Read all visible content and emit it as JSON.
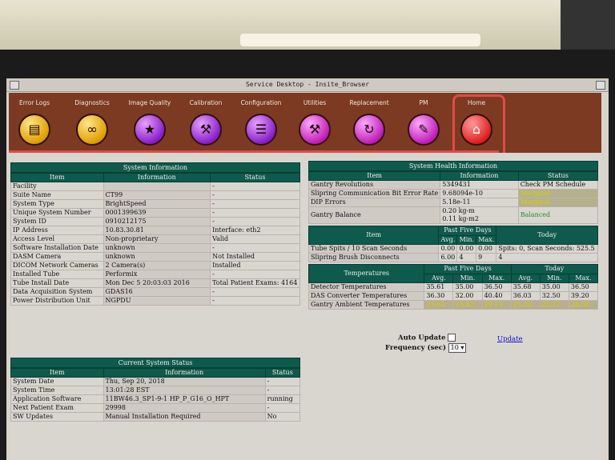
{
  "window": {
    "title": "Service Desktop - Insite_Browser"
  },
  "nav": {
    "items": [
      {
        "label": "Error Logs",
        "icon": "error-log-icon"
      },
      {
        "label": "Diagnostics",
        "icon": "stethoscope-icon"
      },
      {
        "label": "Image Quality",
        "icon": "monitor-star-icon"
      },
      {
        "label": "Calibration",
        "icon": "wrench-icon"
      },
      {
        "label": "Configuration",
        "icon": "checklist-icon"
      },
      {
        "label": "Utilities",
        "icon": "toolbox-icon"
      },
      {
        "label": "Replacement",
        "icon": "replace-icon"
      },
      {
        "label": "PM",
        "icon": "clipboard-icon"
      },
      {
        "label": "Home",
        "icon": "home-icon"
      }
    ]
  },
  "system_info": {
    "title": "System Information",
    "headers": [
      "Item",
      "Information",
      "Status"
    ],
    "rows": [
      [
        "Facility",
        "",
        "-"
      ],
      [
        "Suite Name",
        "CT99",
        "-"
      ],
      [
        "System Type",
        "BrightSpeed",
        "-"
      ],
      [
        "Unique System Number",
        "0001399639",
        "-"
      ],
      [
        "System ID",
        "0910212175",
        "-"
      ],
      [
        "IP Address",
        "10.83.30.81",
        "Interface: eth2"
      ],
      [
        "Access Level",
        "Non-proprietary",
        "Valid"
      ],
      [
        "Software Installation Date",
        "unknown",
        "-"
      ],
      [
        "DASM Camera",
        "unknown",
        "Not Installed"
      ],
      [
        "DICOM Network Cameras",
        "2 Camera(s)",
        "Installed"
      ],
      [
        "Installed Tube",
        "Performix",
        "-"
      ],
      [
        "Tube Install Date",
        "Mon Dec 5 20:03:03 2016",
        "Total Patient Exams: 4164"
      ],
      [
        "Data Acquisition System",
        "GDAS16",
        "-"
      ],
      [
        "Power Distribution Unit",
        "NGPDU",
        "-"
      ]
    ]
  },
  "current_status": {
    "title": "Current System Status",
    "headers": [
      "Item",
      "Information",
      "Status"
    ],
    "rows": [
      [
        "System Date",
        "Thu, Sep 20, 2018",
        "-"
      ],
      [
        "System Time",
        "13:01:28 EST",
        "-"
      ],
      [
        "Application Software",
        "11BW46.3_SP1-9-1 HP_P_G16_O_HPT",
        "running"
      ],
      [
        "Next Patient Exam",
        "29998",
        "-"
      ],
      [
        "SW Updates",
        "Manual Installation Required",
        "No"
      ]
    ]
  },
  "health": {
    "title": "System Health Information",
    "headers": [
      "Item",
      "Information",
      "Status"
    ],
    "rows": [
      {
        "item": "Gantry Revolutions",
        "info": "5349431",
        "status": "Check PM Schedule",
        "status_color": ""
      },
      {
        "item": "Slipring Communication Bit Error Rate",
        "info": "9.68094e-10",
        "status": "Marginal",
        "status_color": "yellow"
      },
      {
        "item": "DIP Errors",
        "info": "5.18e-11",
        "status": "Marginal",
        "status_color": "yellow"
      },
      {
        "item": "Gantry Balance",
        "info": "0.20 kg-m",
        "info2": "0.11 kg-m2",
        "status": "Balanced",
        "status_color": "green"
      }
    ],
    "five_day": {
      "item_header": "Item",
      "past_header": "Past Five Days",
      "today_header": "Today",
      "sub": [
        "Avg.",
        "Min.",
        "Max."
      ],
      "rows": [
        {
          "item": "Tube Spits / 10 Scan Seconds",
          "avg": "0.00",
          "min": "0.00",
          "max": "0.00",
          "today": "Spits: 0, Scan Seconds: 525.5"
        },
        {
          "item": "Slipring Brush Disconnects",
          "avg": "6.00",
          "min": "4",
          "max": "9",
          "today": "4"
        }
      ]
    },
    "temps": {
      "item_header": "Temperatures",
      "past_header": "Past Five Days",
      "today_header": "Today",
      "sub": [
        "Avg.",
        "Min.",
        "Max.",
        "Avg.",
        "Min.",
        "Max."
      ],
      "rows": [
        {
          "item": "Detector Temperatures",
          "vals": [
            "35.61",
            "35.00",
            "36.50",
            "35.68",
            "35.00",
            "36.50"
          ],
          "yellow": false
        },
        {
          "item": "DAS Converter Temperatures",
          "vals": [
            "36.30",
            "32.00",
            "40.40",
            "36.03",
            "32.50",
            "39.20"
          ],
          "yellow": false
        },
        {
          "item": "Gantry Ambient Temperatures",
          "vals": [
            "25.64",
            "25.42",
            "29.13",
            "25.35",
            "25.17",
            "28.58"
          ],
          "yellow": true
        }
      ]
    }
  },
  "controls": {
    "auto_update_label": "Auto Update",
    "frequency_label": "Frequency (sec)",
    "frequency_value": "10",
    "update_link": "Update"
  },
  "colors": {
    "header_green": "#0e5a4c",
    "nav_bg": "#7c3a22",
    "accent_red": "#e04a4a",
    "marginal": "#d8d000"
  }
}
